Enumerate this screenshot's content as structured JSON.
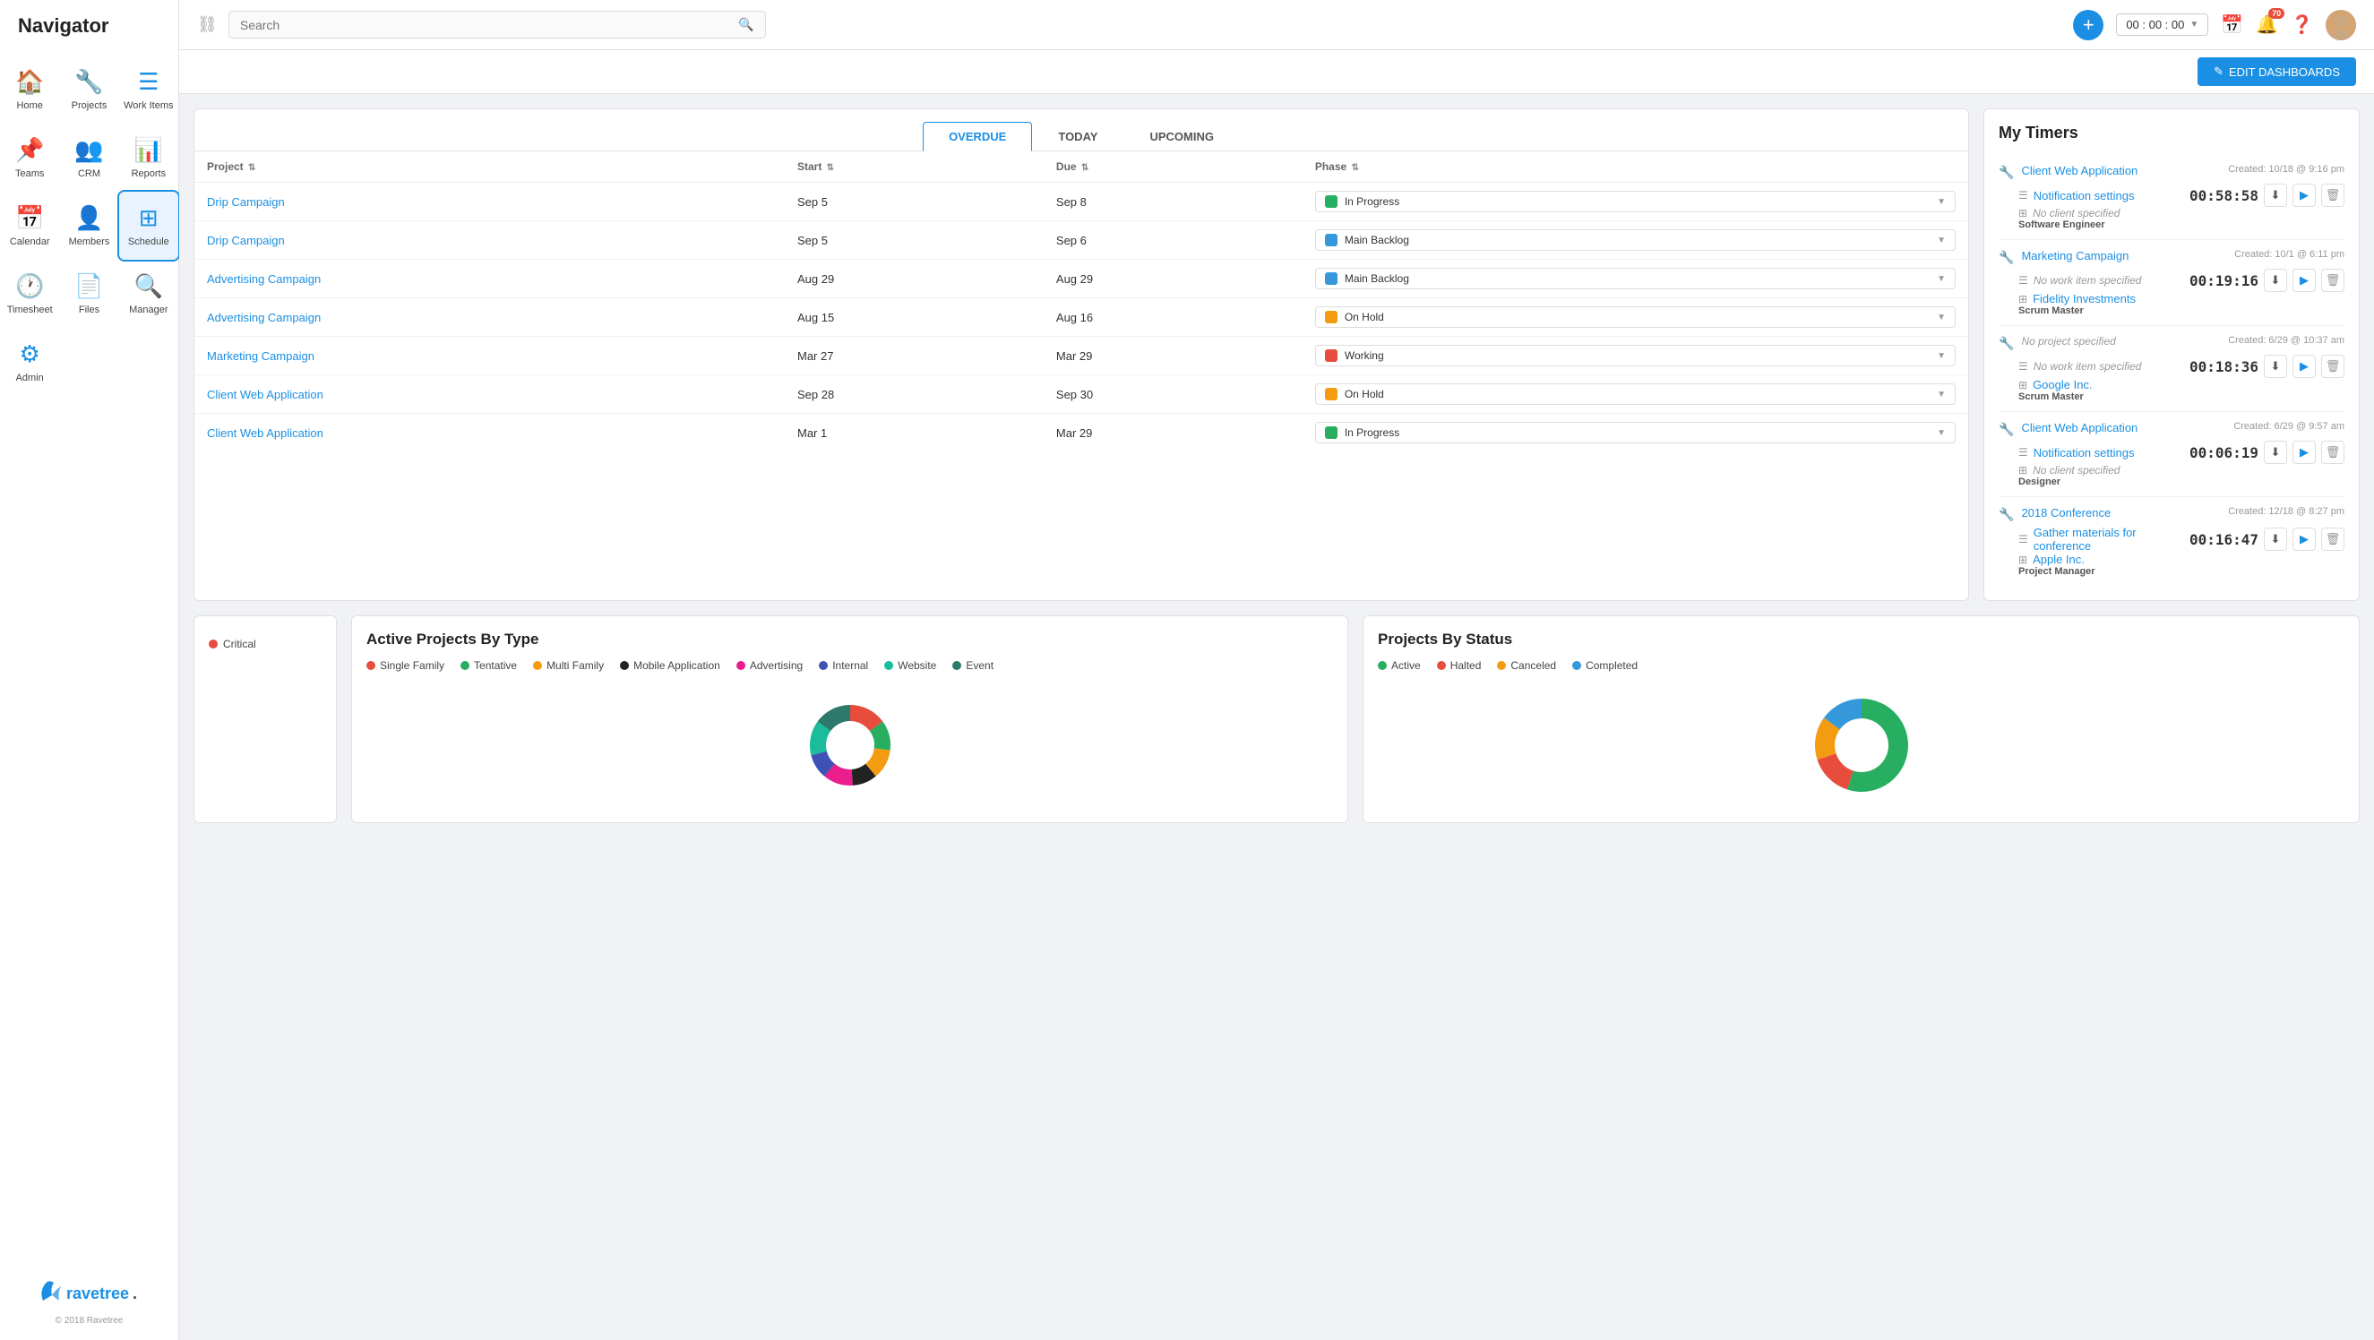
{
  "app": {
    "title": "Navigator",
    "logo_text": "ravetree.",
    "logo_icon": "🦅",
    "copyright": "© 2018 Ravetree"
  },
  "sidebar": {
    "nav_items": [
      {
        "id": "home",
        "label": "Home",
        "icon": "🏠"
      },
      {
        "id": "projects",
        "label": "Projects",
        "icon": "🔧"
      },
      {
        "id": "work-items",
        "label": "Work Items",
        "icon": "☰"
      },
      {
        "id": "teams",
        "label": "Teams",
        "icon": "📌"
      },
      {
        "id": "crm",
        "label": "CRM",
        "icon": "👥"
      },
      {
        "id": "reports",
        "label": "Reports",
        "icon": "📊"
      },
      {
        "id": "calendar",
        "label": "Calendar",
        "icon": "📅"
      },
      {
        "id": "members",
        "label": "Members",
        "icon": "👤"
      },
      {
        "id": "schedule",
        "label": "Schedule",
        "icon": "⊞",
        "active": true
      },
      {
        "id": "timesheet",
        "label": "Timesheet",
        "icon": "🕐"
      },
      {
        "id": "files",
        "label": "Files",
        "icon": "📄"
      },
      {
        "id": "manager",
        "label": "Manager",
        "icon": "🔍"
      },
      {
        "id": "admin",
        "label": "Admin",
        "icon": "⚙"
      }
    ]
  },
  "topbar": {
    "search_placeholder": "Search",
    "timer_value": "00 : 00 : 00",
    "notification_count": "70",
    "add_label": "+"
  },
  "edit_dashboards_btn": "EDIT DASHBOARDS",
  "work_items": {
    "tabs": [
      {
        "id": "overdue",
        "label": "OVERDUE",
        "active": true
      },
      {
        "id": "today",
        "label": "TODAY"
      },
      {
        "id": "upcoming",
        "label": "UPCOMING"
      }
    ],
    "columns": [
      {
        "id": "project",
        "label": "Project"
      },
      {
        "id": "start",
        "label": "Start"
      },
      {
        "id": "due",
        "label": "Due"
      },
      {
        "id": "phase",
        "label": "Phase"
      }
    ],
    "rows": [
      {
        "project": "Drip Campaign",
        "start": "Sep 5",
        "due": "Sep 8",
        "phase": "In Progress",
        "phase_color": "#27ae60"
      },
      {
        "project": "Drip Campaign",
        "start": "Sep 5",
        "due": "Sep 6",
        "phase": "Main Backlog",
        "phase_color": "#3498db"
      },
      {
        "project": "Advertising Campaign",
        "start": "Aug 29",
        "due": "Aug 29",
        "phase": "Main Backlog",
        "phase_color": "#3498db"
      },
      {
        "project": "Advertising Campaign",
        "start": "Aug 15",
        "due": "Aug 16",
        "phase": "On Hold",
        "phase_color": "#f39c12"
      },
      {
        "project": "Marketing Campaign",
        "start": "Mar 27",
        "due": "Mar 29",
        "phase": "Working",
        "phase_color": "#e74c3c"
      },
      {
        "project": "Client Web Application",
        "start": "Sep 28",
        "due": "Sep 30",
        "phase": "On Hold",
        "phase_color": "#f39c12"
      },
      {
        "project": "Client Web Application",
        "start": "Mar 1",
        "due": "Mar 29",
        "phase": "In Progress",
        "phase_color": "#27ae60"
      }
    ]
  },
  "my_timers": {
    "title": "My Timers",
    "entries": [
      {
        "project": "Client Web Application",
        "work_item": "Notification settings",
        "client": "No client specified",
        "created": "Created: 10/18 @ 9:16 pm",
        "time": "00:58:58",
        "role": "Software Engineer",
        "client_is_default": true
      },
      {
        "project": "Marketing Campaign",
        "work_item": "No work item specified",
        "client": "Fidelity Investments",
        "created": "Created: 10/1 @ 6:11 pm",
        "time": "00:19:16",
        "role": "Scrum Master",
        "work_item_is_default": true
      },
      {
        "project": "No project specified",
        "work_item": "No work item specified",
        "client": "Google Inc.",
        "created": "Created: 6/29 @ 10:37 am",
        "time": "00:18:36",
        "role": "Scrum Master",
        "project_is_default": true,
        "work_item_is_default": true
      },
      {
        "project": "Client Web Application",
        "work_item": "Notification settings",
        "client": "No client specified",
        "created": "Created: 6/29 @ 9:57 am",
        "time": "00:06:19",
        "role": "Designer",
        "client_is_default": true
      },
      {
        "project": "2018 Conference",
        "work_item": "Gather materials for conference",
        "client": "Apple Inc.",
        "created": "Created: 12/18 @ 8:27 pm",
        "time": "00:16:47",
        "role": "Project Manager"
      }
    ]
  },
  "active_projects": {
    "title": "Active Projects By Type",
    "legend": [
      {
        "label": "Single Family",
        "color": "#e74c3c"
      },
      {
        "label": "Tentative",
        "color": "#27ae60"
      },
      {
        "label": "Multi Family",
        "color": "#f39c12"
      },
      {
        "label": "Mobile Application",
        "color": "#222"
      },
      {
        "label": "Advertising",
        "color": "#e91e8c"
      },
      {
        "label": "Internal",
        "color": "#3f51b5"
      },
      {
        "label": "Website",
        "color": "#1abc9c"
      },
      {
        "label": "Event",
        "color": "#2c7a6b"
      }
    ],
    "donut_segments": [
      {
        "color": "#e74c3c",
        "value": 15
      },
      {
        "color": "#27ae60",
        "value": 12
      },
      {
        "color": "#f39c12",
        "value": 12
      },
      {
        "color": "#222",
        "value": 10
      },
      {
        "color": "#e91e8c",
        "value": 12
      },
      {
        "color": "#3f51b5",
        "value": 10
      },
      {
        "color": "#1abc9c",
        "value": 14
      },
      {
        "color": "#2c7a6b",
        "value": 15
      }
    ],
    "critical_label": "Critical"
  },
  "projects_by_status": {
    "title": "Projects By Status",
    "legend": [
      {
        "label": "Active",
        "color": "#27ae60"
      },
      {
        "label": "Halted",
        "color": "#e74c3c"
      },
      {
        "label": "Canceled",
        "color": "#f39c12"
      },
      {
        "label": "Completed",
        "color": "#3498db"
      }
    ],
    "donut_segments": [
      {
        "color": "#27ae60",
        "value": 55
      },
      {
        "color": "#e74c3c",
        "value": 15
      },
      {
        "color": "#f39c12",
        "value": 15
      },
      {
        "color": "#3498db",
        "value": 15
      }
    ]
  }
}
